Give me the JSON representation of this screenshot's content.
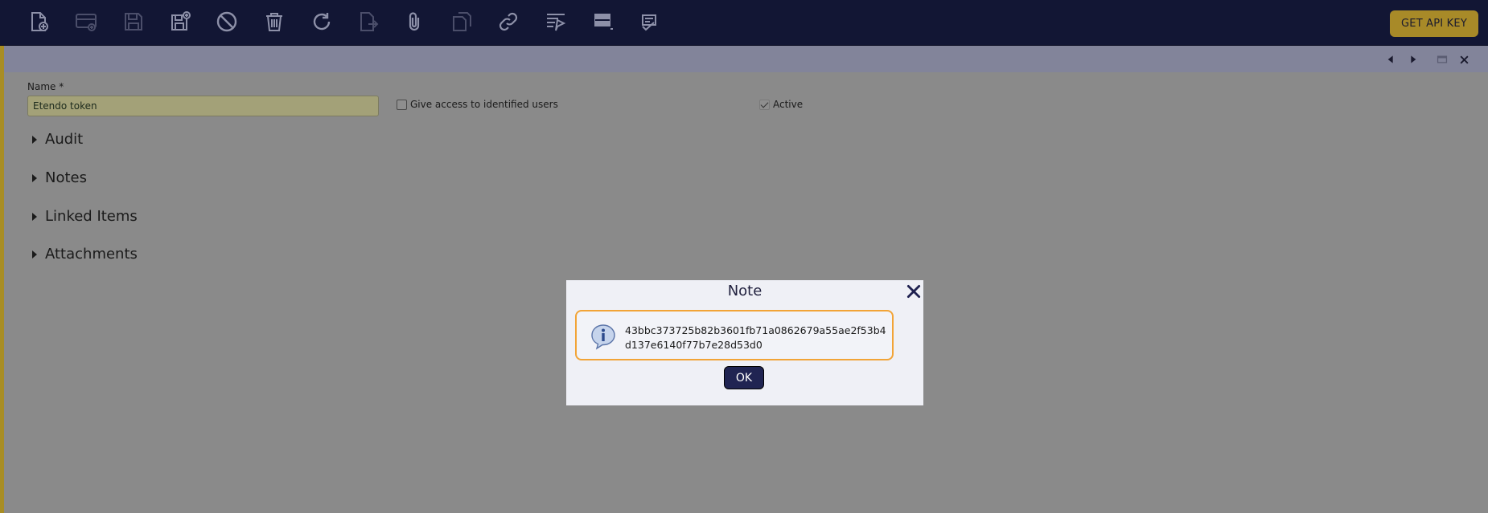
{
  "toolbar": {
    "icons": [
      {
        "name": "new-document-icon"
      },
      {
        "name": "new-row-icon"
      },
      {
        "name": "save-icon"
      },
      {
        "name": "save-and-new-icon"
      },
      {
        "name": "undo-icon"
      },
      {
        "name": "delete-icon"
      },
      {
        "name": "refresh-icon"
      },
      {
        "name": "export-icon"
      },
      {
        "name": "attachment-icon"
      },
      {
        "name": "copy-record-icon"
      },
      {
        "name": "link-icon"
      },
      {
        "name": "filter-icon"
      },
      {
        "name": "grid-view-icon"
      },
      {
        "name": "document-view-icon"
      }
    ],
    "api_key_label": "GET API KEY"
  },
  "form": {
    "name_label": "Name *",
    "name_value": "Etendo token",
    "give_access_label": "Give access to identified users",
    "give_access_checked": false,
    "active_label": "Active",
    "active_checked": true
  },
  "sections": [
    "Audit",
    "Notes",
    "Linked Items",
    "Attachments"
  ],
  "dialog": {
    "title": "Note",
    "message": "43bbc373725b82b3601fb71a0862679a55ae2f53b4d137e6140f77b7e28d53d0",
    "ok_label": "OK"
  },
  "colors": {
    "toolbar_bg": "#121634",
    "accent": "#a88d23",
    "dialog_border": "#f2a437",
    "ok_button": "#202452"
  }
}
